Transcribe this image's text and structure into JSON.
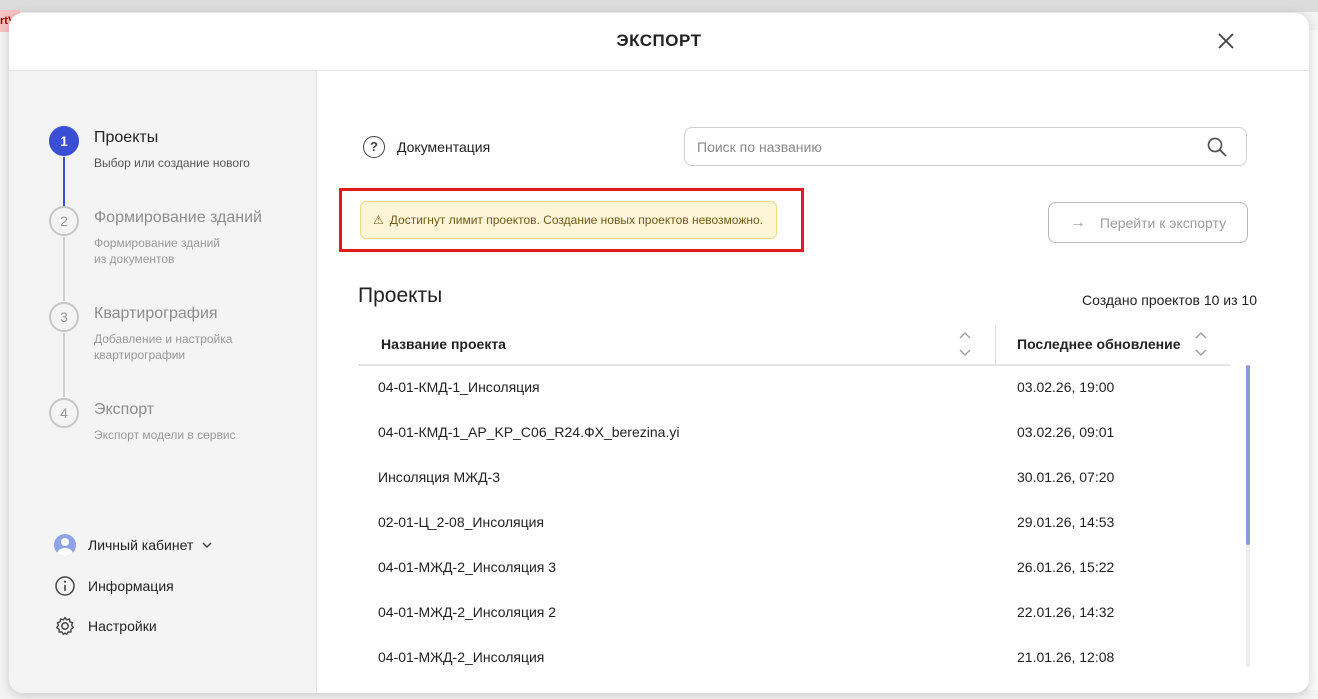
{
  "background": {
    "tag": "rtVi"
  },
  "modal": {
    "title": "ЭКСПОРТ",
    "close_icon": "close-icon"
  },
  "steps": [
    {
      "number": "1",
      "title": "Проекты",
      "subtitle": "Выбор или создание нового",
      "active": true
    },
    {
      "number": "2",
      "title": "Формирование зданий",
      "subtitle": "Формирование зданий из документов",
      "active": false
    },
    {
      "number": "3",
      "title": "Квартирография",
      "subtitle": "Добавление и настройка квартирографии",
      "active": false
    },
    {
      "number": "4",
      "title": "Экспорт",
      "subtitle": "Экспорт модели в сервис",
      "active": false
    }
  ],
  "side_menu": {
    "account": "Личный кабинет",
    "info": "Информация",
    "settings": "Настройки"
  },
  "toolbar": {
    "documentation": "Документация",
    "search_placeholder": "Поиск по названию",
    "warning": "Достигнут лимит проектов. Создание новых проектов невозможно.",
    "go_export": "Перейти к экспорту"
  },
  "projects": {
    "heading": "Проекты",
    "count_text": "Создано проектов 10 из 10",
    "columns": {
      "name": "Название проекта",
      "updated": "Последнее обновление"
    },
    "rows": [
      {
        "name": "04-01-КМД-1_Инсоляция",
        "updated": "03.02.26, 19:00"
      },
      {
        "name": "04-01-КМД-1_AP_KP_C06_R24.ФХ_berezina.yi",
        "updated": "03.02.26, 09:01"
      },
      {
        "name": "Инсоляция МЖД-3",
        "updated": "30.01.26, 07:20"
      },
      {
        "name": "02-01-Ц_2-08_Инсоляция",
        "updated": "29.01.26, 14:53"
      },
      {
        "name": "04-01-МЖД-2_Инсоляция 3",
        "updated": "26.01.26, 15:22"
      },
      {
        "name": "04-01-МЖД-2_Инсоляция 2",
        "updated": "22.01.26, 14:32"
      },
      {
        "name": "04-01-МЖД-2_Инсоляция",
        "updated": "21.01.26, 12:08"
      }
    ]
  },
  "colors": {
    "accent": "#3a4fd6",
    "warning_bg": "#fdf6d6",
    "highlight": "#e01b1b"
  }
}
